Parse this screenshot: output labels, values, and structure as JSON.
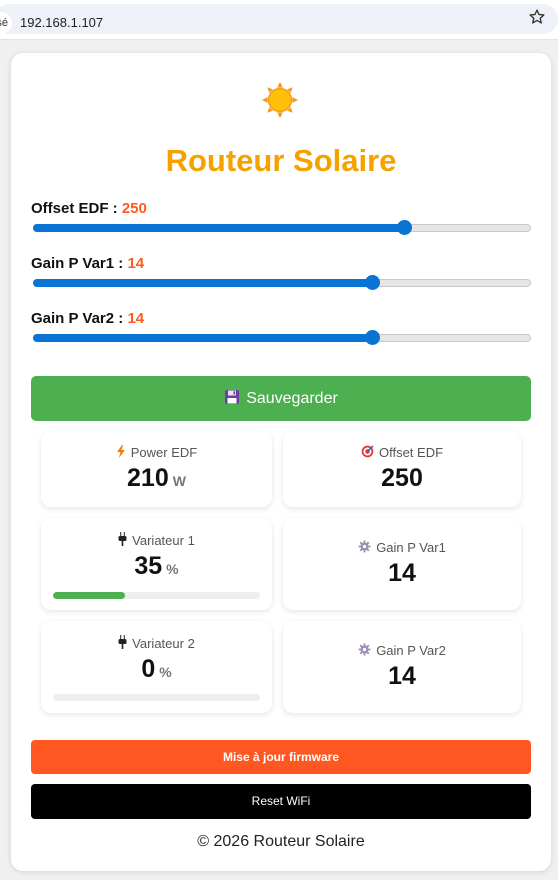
{
  "browser": {
    "security_label": "sé",
    "url": "192.168.1.107"
  },
  "app": {
    "title": "Routeur Solaire"
  },
  "sliders": [
    {
      "label": "Offset EDF :",
      "value": "250",
      "fraction": 0.745
    },
    {
      "label": "Gain P Var1 :",
      "value": "14",
      "fraction": 0.682
    },
    {
      "label": "Gain P Var2 :",
      "value": "14",
      "fraction": 0.682
    }
  ],
  "save_button": {
    "label": "Sauvegarder",
    "icon": "floppy-disk-icon"
  },
  "tiles": {
    "power_edf": {
      "title": "Power EDF",
      "value": "210",
      "unit": "W",
      "icon": "lightning-icon"
    },
    "offset_edf": {
      "title": "Offset EDF",
      "value": "250",
      "icon": "target-icon"
    },
    "variateur1": {
      "title": "Variateur 1",
      "value": "35",
      "unit": "%",
      "progress": 0.35,
      "icon": "plug-icon"
    },
    "gain_var1": {
      "title": "Gain P Var1",
      "value": "14",
      "icon": "gear-icon"
    },
    "variateur2": {
      "title": "Variateur 2",
      "value": "0",
      "unit": "%",
      "progress": 0,
      "icon": "plug-icon"
    },
    "gain_var2": {
      "title": "Gain P Var2",
      "value": "14",
      "icon": "gear-icon"
    }
  },
  "buttons": {
    "firmware": "Mise à jour firmware",
    "reset_wifi": "Reset WiFi"
  },
  "footer": "© 2026 Routeur Solaire",
  "colors": {
    "title": "#f5a100",
    "slider_value": "#ff5a1f",
    "slider_fill": "#0a74d4",
    "save": "#4caf50",
    "firmware": "#ff5722",
    "wifi": "#000000"
  }
}
